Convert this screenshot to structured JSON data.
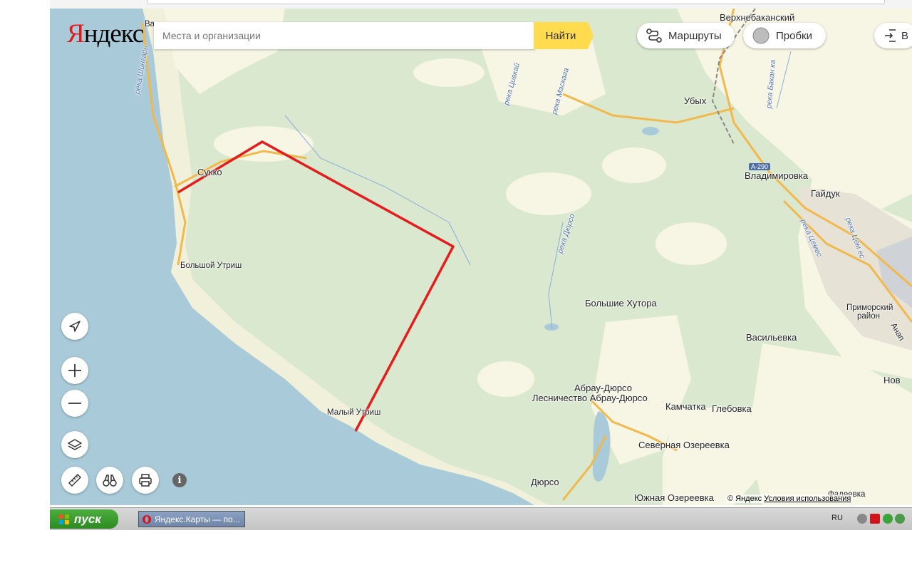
{
  "header": {
    "logo_text": "Яндекс",
    "search_placeholder": "Места и организации",
    "search_button": "Найти",
    "routes_label": "Маршруты",
    "traffic_label": "Пробки",
    "login_label": "В"
  },
  "places": {
    "verkhnebakansky": "Верхнебаканский",
    "ubykh": "Убых",
    "vladimirovka": "Владимировка",
    "gaiduk": "Гайдук",
    "sukko": "Сукко",
    "bolshoy_utrish": "Большой Утриш",
    "malyi_utrish": "Малый Утриш",
    "bolshie_khutora": "Большие Хутора",
    "vasilyevka": "Васильевка",
    "abrau_durso": "Абрау-Дюрсо",
    "lesnichestvo": "Лесничество Абрау-Дюрсо",
    "kamchatka": "Камчатка",
    "glebovka": "Глебовка",
    "severnaya_ozereevka": "Северная Озереевка",
    "durso": "Дюрсо",
    "yuzhnaya_ozereevka": "Южная Озереевка",
    "primorsky_1": "Приморский",
    "primorsky_2": "район",
    "nov": "Нов",
    "anap": "Анап",
    "fadeevka": "Фадеевка",
    "va": "Ва"
  },
  "rivers": {
    "shingar": "река Шингарь",
    "tsivkay": "река Цивкай",
    "maskaga": "река Маскага",
    "bakanka": "река Бакан ка",
    "durso": "река Дюрсо",
    "tsemes_1": "река Цемес",
    "tsemes_2": "река Цем ес"
  },
  "roads": {
    "a290": "А-290"
  },
  "footer": {
    "copyright": "© Яндекс",
    "terms": "Условия использования"
  },
  "taskbar": {
    "start": "пуск",
    "window_title": "Яндекс.Карты — по...",
    "lang": "RU"
  },
  "colors": {
    "sea": "#a9cad9",
    "forest": "#d9e8cf",
    "route": "#e41c1c",
    "search_button": "#ffdb4d",
    "road": "#f2b84b"
  },
  "icons": [
    "navigation-arrow-icon",
    "zoom-in-icon",
    "zoom-out-icon",
    "layers-icon",
    "ruler-icon",
    "binoculars-icon",
    "print-icon",
    "info-icon",
    "routes-icon",
    "traffic-icon",
    "login-icon",
    "windows-logo-icon",
    "opera-icon"
  ]
}
